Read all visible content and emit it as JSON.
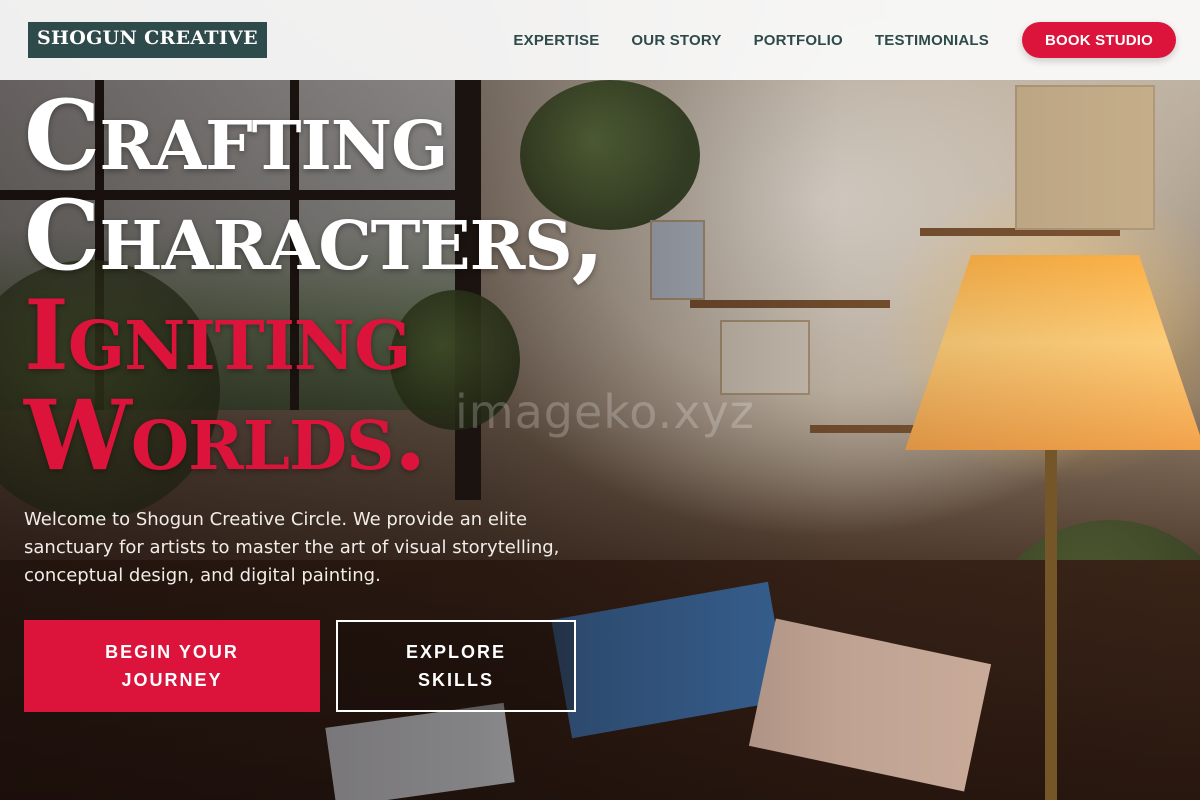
{
  "brand": {
    "name": "SHOGUN CREATIVE"
  },
  "nav": {
    "links": [
      {
        "label": "EXPERTISE"
      },
      {
        "label": "OUR STORY"
      },
      {
        "label": "PORTFOLIO"
      },
      {
        "label": "TESTIMONIALS"
      }
    ],
    "cta_label": "BOOK STUDIO"
  },
  "hero": {
    "title_lines": [
      {
        "text": "Crafting",
        "style": "white"
      },
      {
        "text": "Characters,",
        "style": "white"
      },
      {
        "text": "Igniting",
        "style": "red"
      },
      {
        "text": "Worlds.",
        "style": "red"
      }
    ],
    "description": "Welcome to Shogun Creative Circle. We provide an elite sanctuary for artists to master the art of visual storytelling, conceptual design, and digital painting.",
    "primary_cta": "BEGIN YOUR JOURNEY",
    "secondary_cta": "EXPLORE SKILLS",
    "background_watermark": "imageko.xyz"
  },
  "colors": {
    "accent": "#dc143c",
    "brand_bg": "#2e4a4a",
    "header_bg": "#fafafa"
  }
}
